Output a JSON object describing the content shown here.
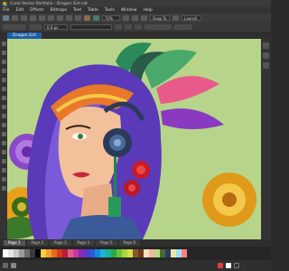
{
  "window": {
    "title": "Corel Vector Portfolio - Dragon Girl.cdr"
  },
  "menu": [
    "File",
    "Edit",
    "Effects",
    "Bitmaps",
    "Text",
    "Table",
    "Tools",
    "Window",
    "Help"
  ],
  "toolbar": {
    "zoom": "72%",
    "snap": "Snap To",
    "launch": "Launch"
  },
  "property_bar": {
    "nudge": "0.0 px"
  },
  "document_tab": "Dragon Girl",
  "page_tabs": [
    "Page 1",
    "Page 2",
    "Page 3",
    "Page 4",
    "Page 5",
    "Page 6"
  ],
  "palette": [
    "#ffffff",
    "#e6e6e6",
    "#c8c8c8",
    "#9a9a9a",
    "#6a6a6a",
    "#3a3a3a",
    "#000000",
    "#f4d03f",
    "#f0a030",
    "#e86a1c",
    "#d63a1a",
    "#b81c3a",
    "#e05a8a",
    "#c43a9a",
    "#8a2ab8",
    "#5a3ad0",
    "#2a5ad8",
    "#1a8ae0",
    "#1ab4d8",
    "#18b49a",
    "#2aa84a",
    "#6ac43a",
    "#a8d43a",
    "#d4e04a",
    "#8a5a2a",
    "#6a3a1a",
    "#f8e0c0",
    "#f0b8a0",
    "#b8d88a",
    "#4a6a2a",
    "#2a3a6a",
    "#e8e8a8",
    "#a0e0f0",
    "#ff8080"
  ],
  "colors": {
    "canvas_bg": "#b7d58a",
    "accent_tab": "#1e5fa8"
  }
}
